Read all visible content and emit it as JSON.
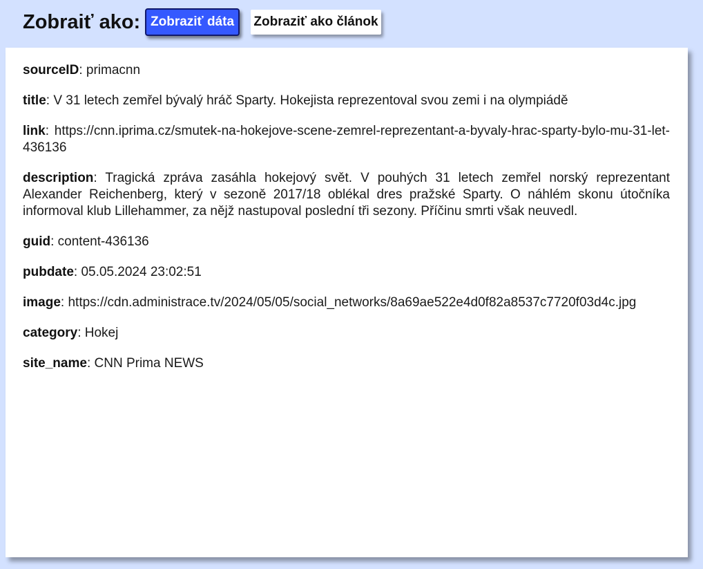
{
  "toolbar": {
    "view_label": "Zobraiť ako:",
    "data_button": "Zobraziť dáta",
    "article_button": "Zobraziť ako článok"
  },
  "fields": [
    {
      "key": "sourceID",
      "sep": ": ",
      "value": "primacnn"
    },
    {
      "key": "title",
      "sep": ": ",
      "value": "V 31 letech zemřel bývalý hráč Sparty. Hokejista reprezentoval svou zemi i na olympiádě"
    },
    {
      "key": "link",
      "sep": ": ",
      "value": "https://cnn.iprima.cz/smutek-na-hokejove-scene-zemrel-reprezentant-a-byvaly-hrac-sparty-bylo-mu-31-let-436136"
    },
    {
      "key": "description",
      "sep": ": ",
      "value": "Tragická zpráva zasáhla hokejový svět. V pouhých 31 letech zemřel norský reprezentant Alexander Reichenberg, který v sezoně 2017/18 oblékal dres pražské Sparty. O náhlém skonu útočníka informoval klub Lillehammer, za nějž nastupoval poslední tři sezony. Příčinu smrti však neuvedl."
    },
    {
      "key": "guid",
      "sep": ": ",
      "value": "content-436136"
    },
    {
      "key": "pubdate",
      "sep": ": ",
      "value": "05.05.2024 23:02:51"
    },
    {
      "key": "image",
      "sep": ": ",
      "value": "https://cdn.administrace.tv/2024/05/05/social_networks/8a69ae522e4d0f82a8537c7720f03d4c.jpg"
    },
    {
      "key": "category",
      "sep": ": ",
      "value": "Hokej"
    },
    {
      "key": "site_name",
      "sep": ": ",
      "value": "CNN Prima NEWS"
    }
  ]
}
